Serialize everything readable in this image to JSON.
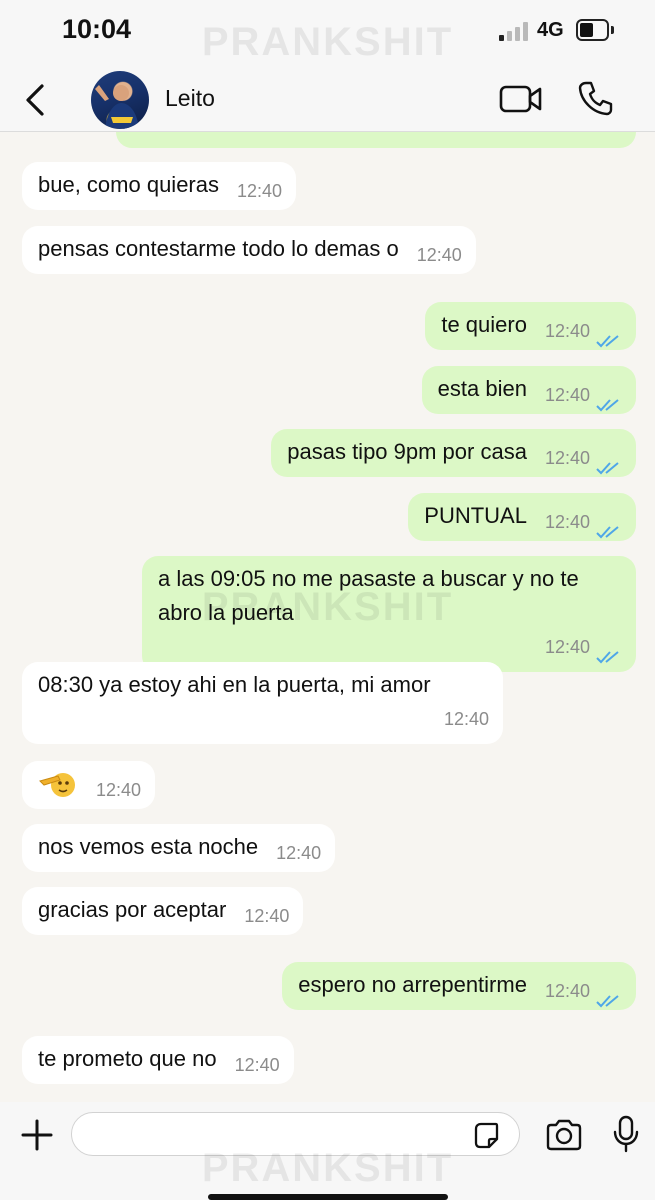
{
  "status_bar": {
    "time": "10:04",
    "network": "4G",
    "battery_level": 0.3
  },
  "header": {
    "contact_name": "Leito"
  },
  "watermark": "PRANKSHIT",
  "messages": [
    {
      "dir": "in",
      "text": "bue, como quieras",
      "time": "12:40"
    },
    {
      "dir": "in",
      "text": "pensas contestarme todo lo demas o",
      "time": "12:40"
    },
    {
      "dir": "out",
      "text": "te quiero",
      "time": "12:40"
    },
    {
      "dir": "out",
      "text": "esta bien",
      "time": "12:40"
    },
    {
      "dir": "out",
      "text": "pasas tipo 9pm por casa",
      "time": "12:40"
    },
    {
      "dir": "out",
      "text": "PUNTUAL",
      "time": "12:40"
    },
    {
      "dir": "out",
      "text": "a las 09:05 no me pasaste a buscar y no te abro la puerta",
      "time": "12:40"
    },
    {
      "dir": "in",
      "text": "08:30 ya estoy ahi en la puerta, mi amor",
      "time": "12:40"
    },
    {
      "dir": "in",
      "text": "",
      "emoji": "saluting-face",
      "time": "12:40"
    },
    {
      "dir": "in",
      "text": "nos vemos esta noche",
      "time": "12:40"
    },
    {
      "dir": "in",
      "text": "gracias por aceptar",
      "time": "12:40"
    },
    {
      "dir": "out",
      "text": "espero no arrepentirme",
      "time": "12:40"
    },
    {
      "dir": "in",
      "text": "te prometo que no",
      "time": "12:40"
    }
  ],
  "composer": {
    "placeholder": ""
  },
  "icons": {
    "back": "chevron-left-icon",
    "video": "video-camera-icon",
    "call": "phone-icon",
    "plus": "plus-icon",
    "sticker": "sticker-icon",
    "camera": "camera-icon",
    "mic": "microphone-icon",
    "read_receipt": "double-check-icon"
  },
  "colors": {
    "incoming_bubble": "#ffffff",
    "outgoing_bubble": "#dcf8c6",
    "read_ticks": "#4fa6e8",
    "background": "#f7f5f1"
  }
}
